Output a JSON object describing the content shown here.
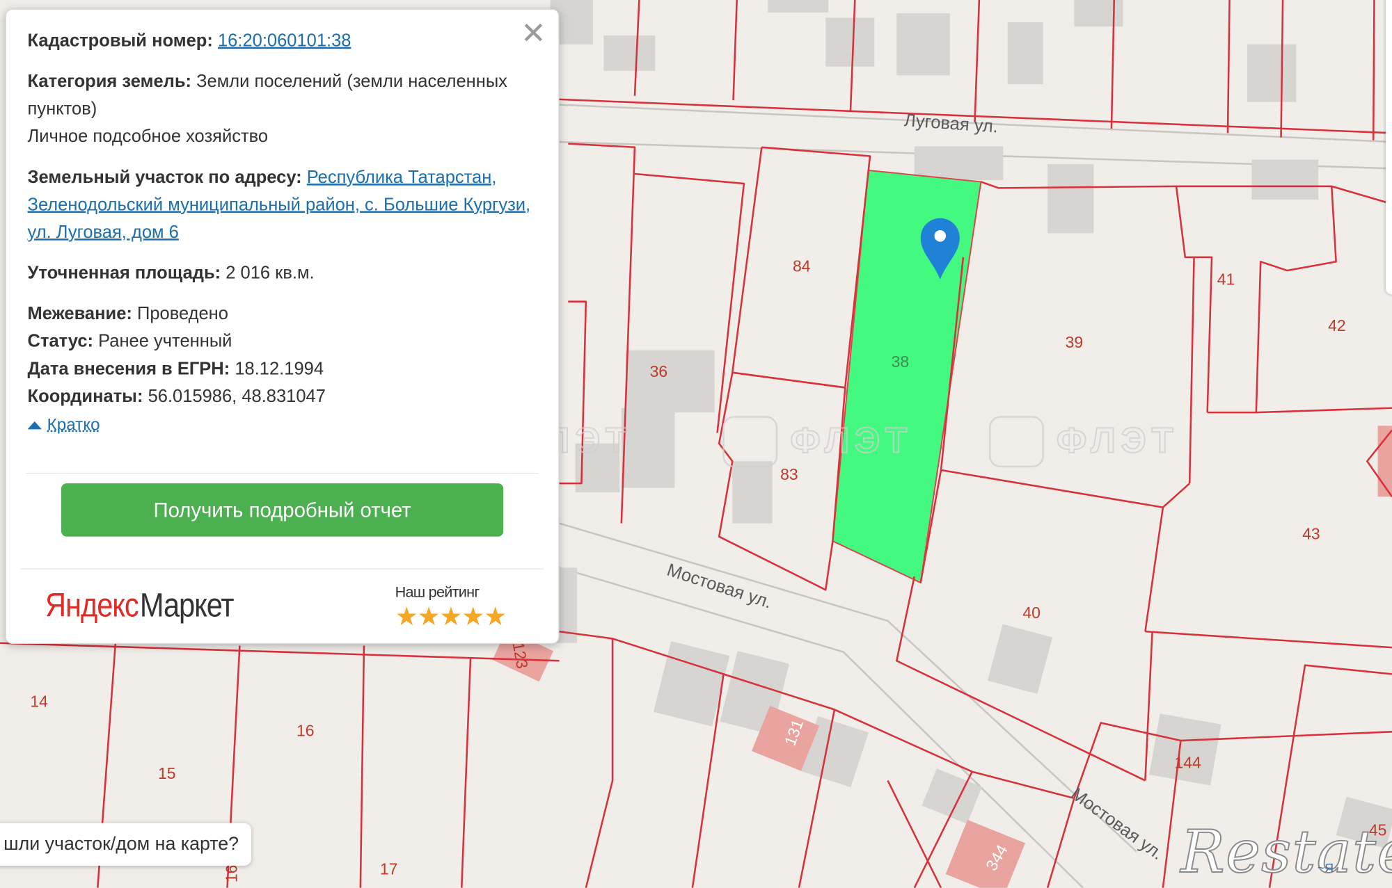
{
  "streets": {
    "lugovaya": "Луговая ул.",
    "mostovaya": "Мостовая ул."
  },
  "plots": {
    "p84": "84",
    "p38": "38",
    "p39": "39",
    "p41": "41",
    "p42": "42",
    "p43": "43",
    "p40": "40",
    "p36": "36",
    "p83": "83",
    "p14": "14",
    "p15": "15",
    "p16": "16",
    "p17": "17",
    "p144": "144",
    "p45": "45",
    "b123": "123",
    "b131": "131",
    "b344": "344",
    "b16": "16"
  },
  "watermark": "ФЛЭТ",
  "panel": {
    "cadastral_label": "Кадастровый номер:",
    "cadastral_value": "16:20:060101:38",
    "category_label": "Категория земель:",
    "category_value": "Земли поселений (земли населенных пунктов)",
    "usage": "Личное подсобное хозяйство",
    "address_label": "Земельный участок по адресу:",
    "address_value": "Республика Татарстан, Зеленодольский муниципальный район, с. Большие Кургузи, ул. Луговая, дом 6",
    "area_label": "Уточненная площадь:",
    "area_value": "2 016 кв.м.",
    "survey_label": "Межевание:",
    "survey_value": "Проведено",
    "status_label": "Статус:",
    "status_value": "Ранее учтенный",
    "date_label": "Дата внесения в ЕГРН:",
    "date_value": "18.12.1994",
    "coords_label": "Координаты:",
    "coords_value": "56.015986, 48.831047",
    "collapse_label": "Кратко",
    "report_button": "Получить подробный отчет",
    "brand_yandex": "Яндекс",
    "brand_market": "Маркет",
    "rating_label": "Наш рейтинг",
    "rating_stars": "★★★★★"
  },
  "hint": "шли участок/дом на карте?",
  "watermark_logo": "Restate",
  "map_credit": "~Я"
}
